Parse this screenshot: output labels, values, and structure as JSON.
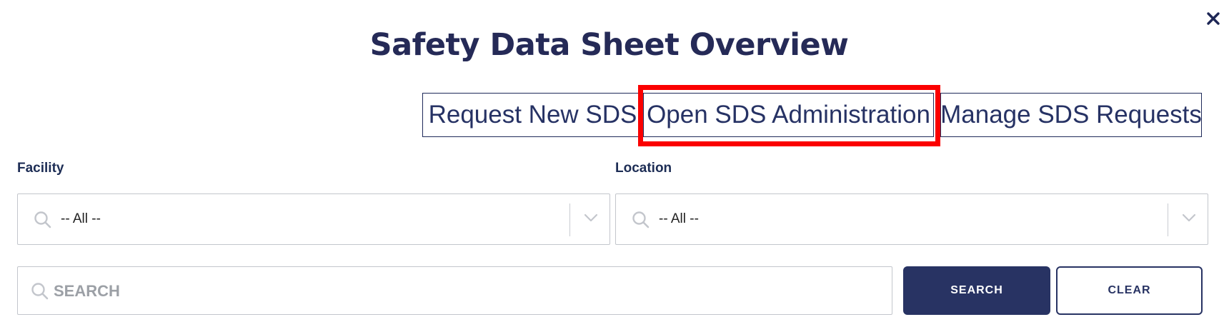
{
  "dialog": {
    "title": "Safety Data Sheet Overview",
    "close_icon": "close-icon"
  },
  "actions": {
    "request_new": "Request New SDS",
    "open_admin": "Open SDS Administration",
    "manage_requests": "Manage SDS Requests"
  },
  "filters": {
    "facility": {
      "label": "Facility",
      "value": "-- All --"
    },
    "location": {
      "label": "Location",
      "value": "-- All --"
    }
  },
  "search": {
    "placeholder": "SEARCH",
    "value": "",
    "search_button": "SEARCH",
    "clear_button": "CLEAR"
  },
  "colors": {
    "primary": "#283363",
    "highlight": "#fb0000",
    "border": "#c3c6cc"
  }
}
